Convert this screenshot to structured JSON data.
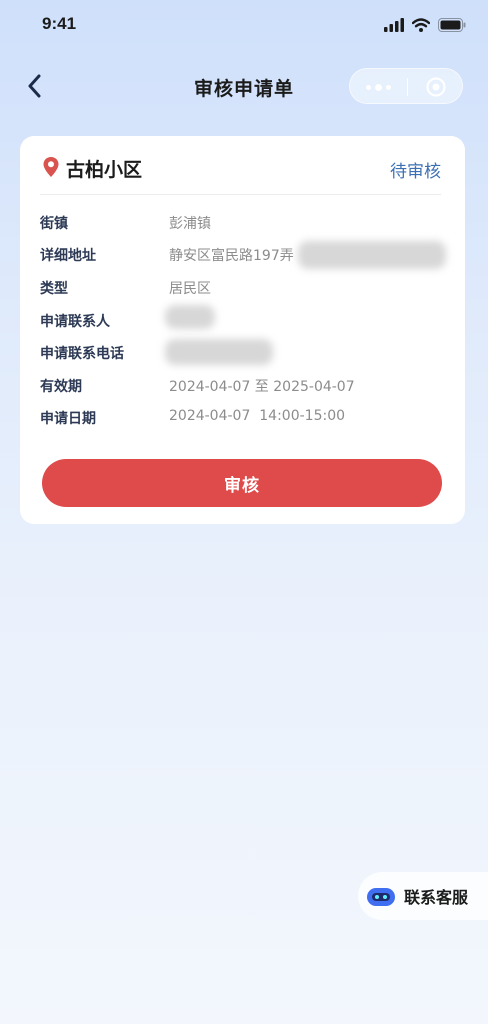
{
  "status_bar": {
    "time": "9:41"
  },
  "nav": {
    "title": "审核申请单"
  },
  "card": {
    "community_name": "古柏小区",
    "status": "待审核",
    "rows": [
      {
        "label": "街镇",
        "value": "彭浦镇"
      },
      {
        "label": "详细地址",
        "value": "静安区富民路197弄"
      },
      {
        "label": "类型",
        "value": "居民区"
      },
      {
        "label": "申请联系人",
        "value": ""
      },
      {
        "label": "申请联系电话",
        "value": ""
      },
      {
        "label": "有效期",
        "value": "2024-04-07 至 2025-04-07"
      },
      {
        "label": "申请日期",
        "value": "2024-04-07  14:00-15:00"
      }
    ],
    "review_button": "审核"
  },
  "service": {
    "label": "联系客服"
  },
  "colors": {
    "accent_red": "#df4a4a",
    "status_blue": "#3d6fb3",
    "label_navy": "#2d3a55",
    "value_gray": "#8c8c8c"
  }
}
